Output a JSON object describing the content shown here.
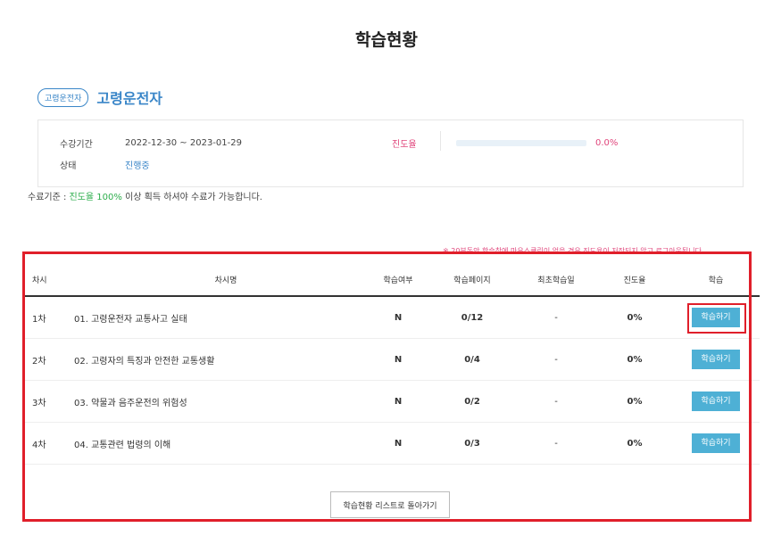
{
  "page": {
    "title": "학습현황"
  },
  "course": {
    "tag": "고령운전자",
    "name": "고령운전자"
  },
  "info": {
    "period_label": "수강기간",
    "period_value": "2022-12-30 ~ 2023-01-29",
    "status_label": "상태",
    "status_value": "진행중",
    "progress_label": "진도율",
    "progress_value": "0.0%",
    "progress_fraction": 0.0
  },
  "criteria": {
    "prefix": "수료기준 : ",
    "highlight": "진도율 100%",
    "suffix": " 이상 획득 하셔야 수료가 가능합니다."
  },
  "notice": "※ 20분동안 학습창에 마우스클릭이 없을 경우 진도율이 저장되지 않고 로그아웃됩니다.",
  "table": {
    "headers": [
      "차시",
      "차시명",
      "학습여부",
      "학습페이지",
      "최초학습일",
      "진도율",
      "학습"
    ],
    "rows": [
      {
        "no": "1차",
        "title": "01. 고령운전자 교통사고 실태",
        "done": "N",
        "page": "0/12",
        "first": "-",
        "progress": "0%",
        "button": "학습하기"
      },
      {
        "no": "2차",
        "title": "02. 고령자의 특징과 안전한 교통생활",
        "done": "N",
        "page": "0/4",
        "first": "-",
        "progress": "0%",
        "button": "학습하기"
      },
      {
        "no": "3차",
        "title": "03. 약물과 음주운전의 위험성",
        "done": "N",
        "page": "0/2",
        "first": "-",
        "progress": "0%",
        "button": "학습하기"
      },
      {
        "no": "4차",
        "title": "04. 교통관련 법령의 이해",
        "done": "N",
        "page": "0/3",
        "first": "-",
        "progress": "0%",
        "button": "학습하기"
      }
    ]
  },
  "back_button": "학습현황 리스트로 돌아가기",
  "colors": {
    "accent": "#3a86c8",
    "pink": "#e0457b",
    "green": "#2eae4d",
    "button": "#4eb0d5",
    "highlight": "#e01f2a"
  }
}
